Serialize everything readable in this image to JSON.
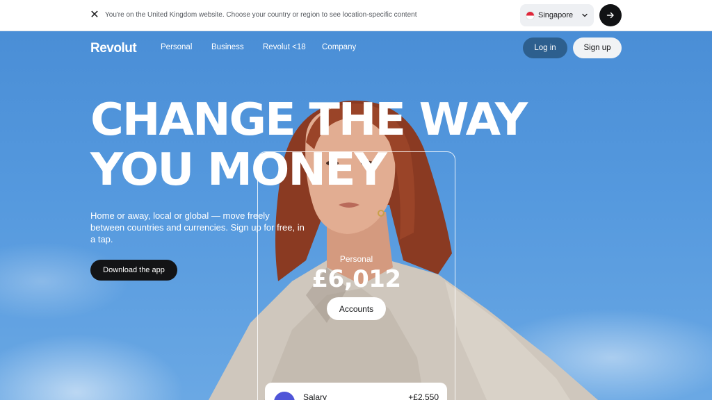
{
  "region_banner": {
    "message": "You're on the United Kingdom website. Choose your country or region to see location-specific content",
    "selected_country": "Singapore",
    "close_icon": "close-icon",
    "go_icon": "arrow-right-icon"
  },
  "nav": {
    "logo": "Revolut",
    "items": [
      "Personal",
      "Business",
      "Revolut <18",
      "Company"
    ],
    "login_label": "Log in",
    "signup_label": "Sign up"
  },
  "hero": {
    "headline_line1": "CHANGE THE WAY",
    "headline_line2": "YOU MONEY",
    "subtext": "Home or away, local or global — move freely between countries and currencies. Sign up for free, in a tap.",
    "cta_label": "Download the app"
  },
  "card": {
    "label": "Personal",
    "amount": "£6,012",
    "accounts_label": "Accounts",
    "transaction": {
      "title": "Salary",
      "amount": "+£2,550"
    }
  },
  "colors": {
    "sky": "#4a8fd6",
    "dark": "#111214",
    "login_bg": "#2d5f8e",
    "txn_icon": "#4f55d8"
  }
}
